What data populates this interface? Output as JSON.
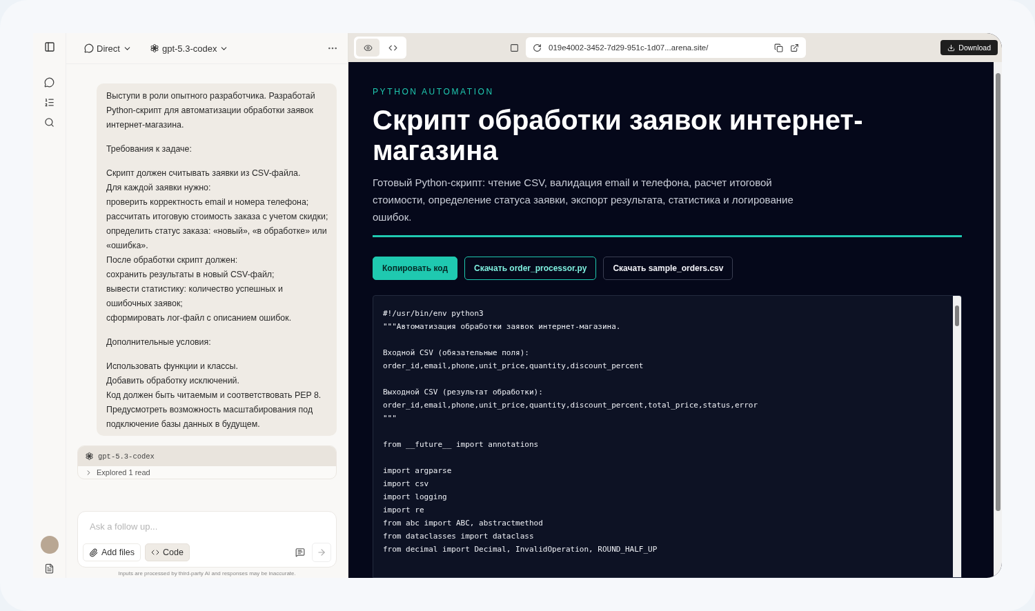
{
  "chat_header": {
    "mode": "Direct",
    "model": "gpt-5.3-codex"
  },
  "user_message": {
    "paragraphs": [
      [
        "Выступи в роли опытного разработчика. Разработай Python-скрипт для автоматизации обработки заявок интернет-магазина."
      ],
      [
        "Требования к задаче:"
      ],
      [
        "Скрипт должен считывать заявки из CSV-файла.",
        "Для каждой заявки нужно:",
        "проверить корректность email и номера телефона;",
        "рассчитать итоговую стоимость заказа с учетом скидки;",
        "определить статус заказа: «новый», «в обработке» или «ошибка».",
        "После обработки скрипт должен:",
        "сохранить результаты в новый CSV-файл;",
        "вывести статистику: количество успешных и ошибочных заявок;",
        "сформировать лог-файл с описанием ошибок."
      ],
      [
        "Дополнительные условия:"
      ],
      [
        "Использовать функции и классы.",
        "Добавить обработку исключений.",
        "Код должен быть читаемым и соответствовать PEP 8.",
        "Предусмотреть возможность масштабирования под подключение базы данных в будущем."
      ]
    ]
  },
  "assistant_card": {
    "model": "gpt-5.3-codex",
    "step": "Explored 1 read"
  },
  "composer": {
    "placeholder": "Ask a follow up...",
    "buttons": [
      {
        "label": "Add files",
        "kind": "attach",
        "selected": false
      },
      {
        "label": "Code",
        "kind": "code",
        "selected": true
      }
    ],
    "disclaimer": "Inputs are processed by third-party AI and responses may be inaccurate."
  },
  "preview_bar": {
    "tabs": [
      {
        "kind": "preview",
        "selected": true
      },
      {
        "kind": "code",
        "selected": false
      }
    ],
    "url": "019e4002-3452-7d29-951c-1d07...arena.site/",
    "download": "Download"
  },
  "page": {
    "eyebrow": "PYTHON AUTOMATION",
    "title": "Скрипт обработки заявок интернет-магазина",
    "subtitle": "Готовый Python-скрипт: чтение CSV, валидация email и телефона, расчет итоговой стоимости, определение статуса заявки, экспорт результата, статистика и логирование ошибок.",
    "actions": [
      {
        "label": "Копировать код",
        "kind": "primary"
      },
      {
        "label": "Скачать order_processor.py",
        "kind": "accent"
      },
      {
        "label": "Скачать sample_orders.csv",
        "kind": "plain"
      }
    ],
    "code_blocks": [
      [
        "#!/usr/bin/env python3",
        "\"\"\"Автоматизация обработки заявок интернет-магазина."
      ],
      [
        "Входной CSV (обязательные поля):",
        "order_id,email,phone,unit_price,quantity,discount_percent"
      ],
      [
        "Выходной CSV (результат обработки):",
        "order_id,email,phone,unit_price,quantity,discount_percent,total_price,status,error",
        "\"\"\""
      ],
      [
        "from __future__ import annotations"
      ],
      [
        "import argparse",
        "import csv",
        "import logging",
        "import re",
        "from abc import ABC, abstractmethod",
        "from dataclasses import dataclass",
        "from decimal import Decimal, InvalidOperation, ROUND_HALF_UP"
      ]
    ]
  }
}
